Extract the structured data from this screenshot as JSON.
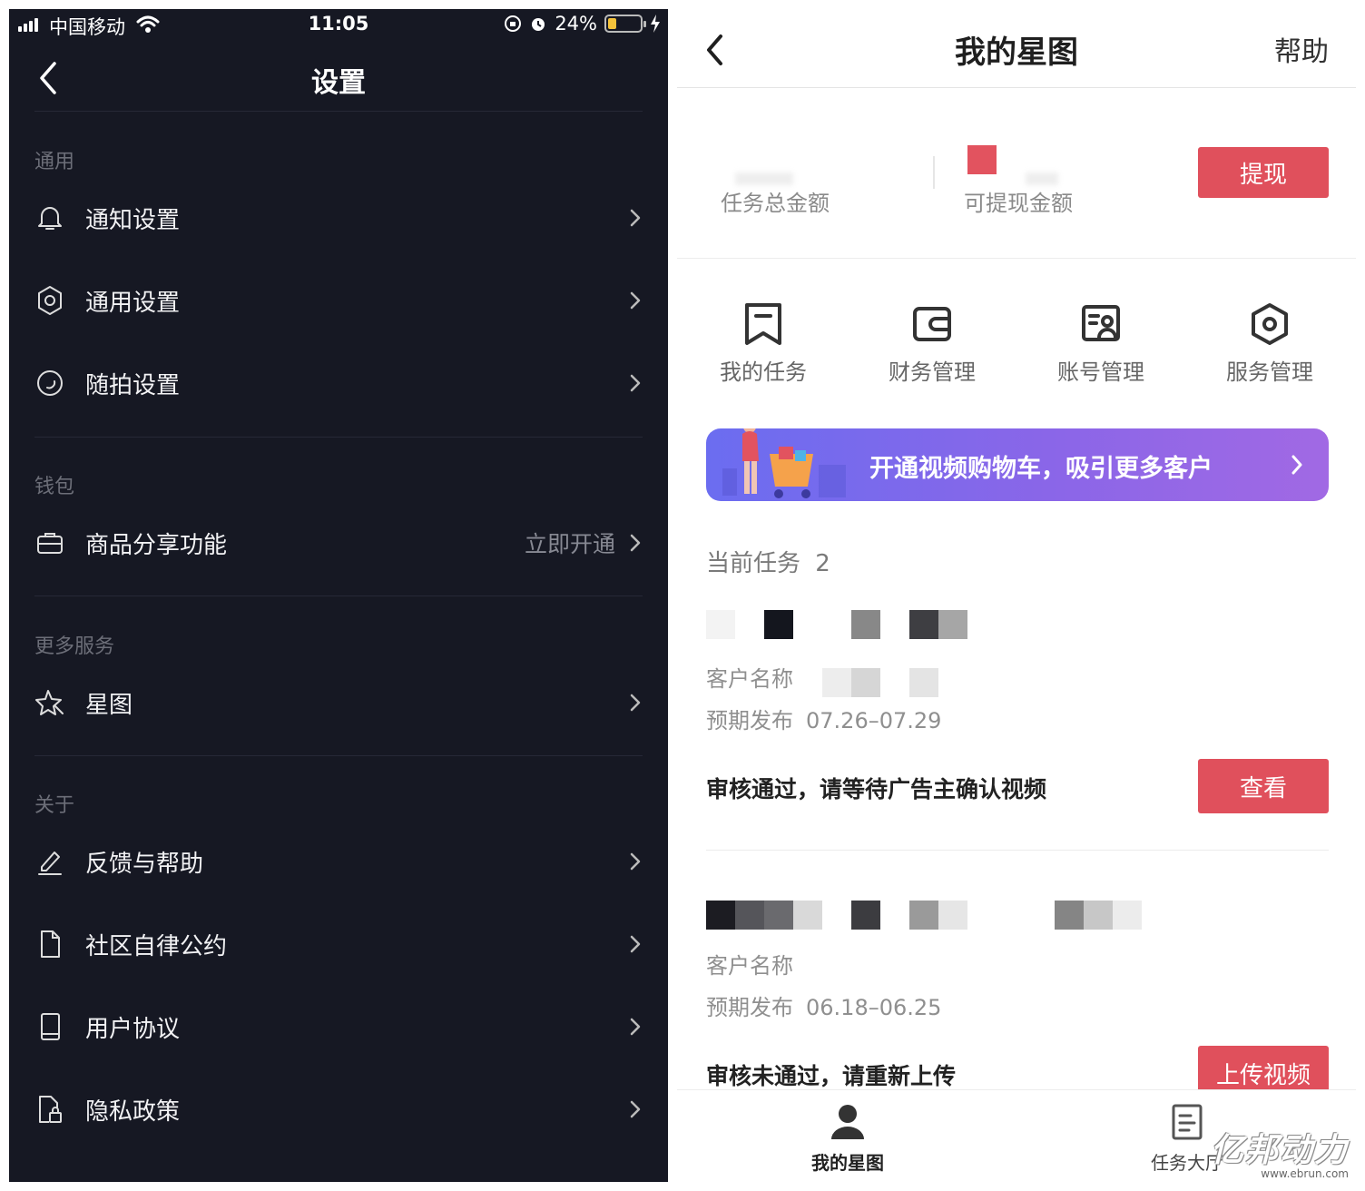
{
  "left": {
    "status_bar": {
      "carrier": "中国移动",
      "time": "11:05",
      "battery": "24%",
      "battery_level": 0.24
    },
    "nav": {
      "title": "设置"
    },
    "sections": [
      {
        "header": "通用",
        "items": [
          {
            "label": "通知设置",
            "icon": "bell-icon"
          },
          {
            "label": "通用设置",
            "icon": "gear-icon"
          },
          {
            "label": "随拍设置",
            "icon": "circle-icon"
          }
        ]
      },
      {
        "header": "钱包",
        "items": [
          {
            "label": "商品分享功能",
            "value": "立即开通",
            "icon": "briefcase-icon"
          }
        ]
      },
      {
        "header": "更多服务",
        "items": [
          {
            "label": "星图",
            "icon": "star-icon"
          }
        ]
      },
      {
        "header": "关于",
        "items": [
          {
            "label": "反馈与帮助",
            "icon": "pencil-icon"
          },
          {
            "label": "社区自律公约",
            "icon": "document-icon"
          },
          {
            "label": "用户协议",
            "icon": "book-icon"
          },
          {
            "label": "隐私政策",
            "icon": "lock-document-icon"
          }
        ]
      }
    ]
  },
  "right": {
    "nav": {
      "title": "我的星图",
      "help": "帮助"
    },
    "amounts": {
      "total_label": "任务总金额",
      "withdrawable_label": "可提现金额",
      "withdraw_button": "提现"
    },
    "quick_actions": [
      {
        "label": "我的任务",
        "icon": "bookmark-icon"
      },
      {
        "label": "财务管理",
        "icon": "wallet-icon"
      },
      {
        "label": "账号管理",
        "icon": "id-card-icon"
      },
      {
        "label": "服务管理",
        "icon": "hexagon-icon"
      }
    ],
    "banner": {
      "text": "开通视频购物车，吸引更多客户"
    },
    "current_tasks": {
      "label": "当前任务",
      "count": "2"
    },
    "tasks": [
      {
        "client_label": "客户名称",
        "publish_label": "预期发布",
        "publish_dates": "07.26–07.29",
        "status": "审核通过，请等待广告主确认视频",
        "action": "查看"
      },
      {
        "client_label": "客户名称",
        "publish_label": "预期发布",
        "publish_dates": "06.18–06.25",
        "status": "审核未通过，请重新上传",
        "action": "上传视频"
      }
    ],
    "tabbar": [
      {
        "label": "我的星图",
        "icon": "person-icon",
        "active": true
      },
      {
        "label": "任务大厅",
        "icon": "list-document-icon",
        "active": false
      }
    ],
    "watermark": {
      "brand": "亿邦动力",
      "url": "www.ebrun.com"
    },
    "colors": {
      "accent_red": "#e0505c",
      "dark_bg": "#161823",
      "banner_start": "#6b6df0",
      "banner_end": "#a169e4"
    }
  }
}
